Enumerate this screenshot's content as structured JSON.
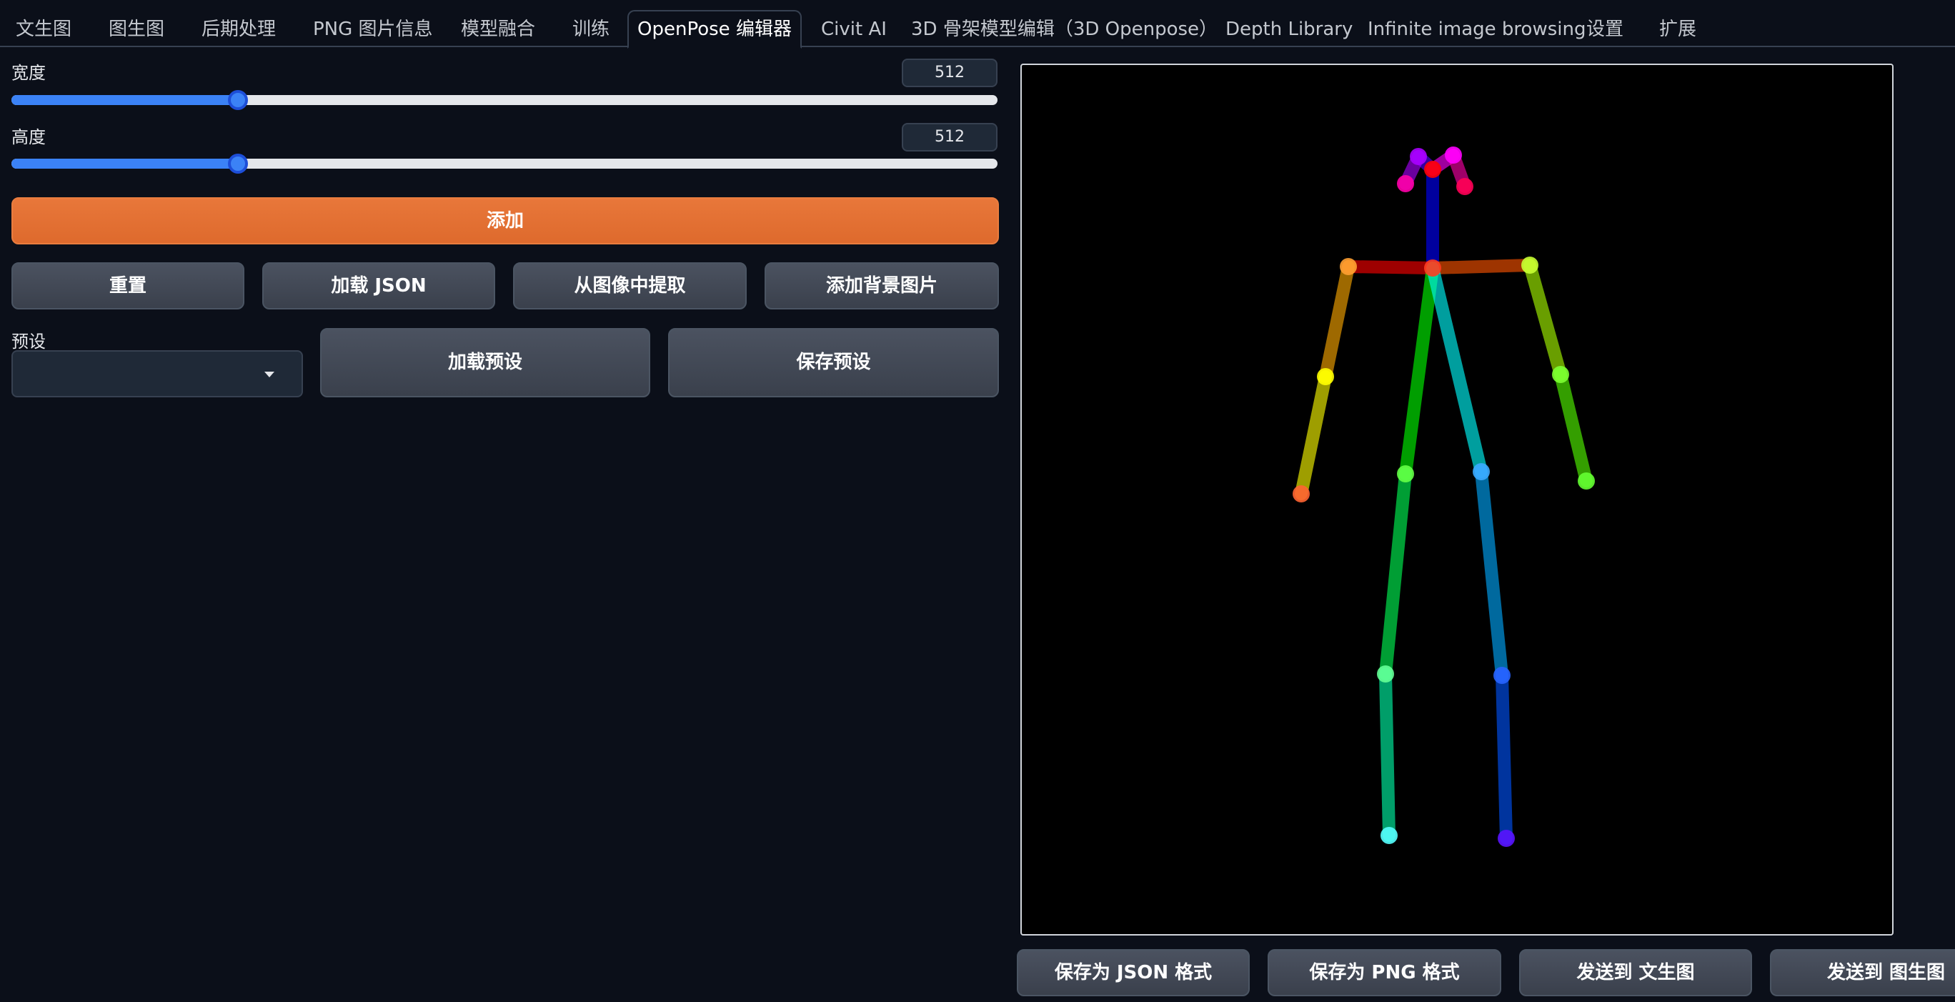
{
  "tabs": [
    {
      "label": "文生图"
    },
    {
      "label": "图生图"
    },
    {
      "label": "后期处理"
    },
    {
      "label": "PNG 图片信息"
    },
    {
      "label": "模型融合"
    },
    {
      "label": "训练"
    },
    {
      "label": "OpenPose 编辑器",
      "active": true
    },
    {
      "label": "Civit AI"
    },
    {
      "label": "3D 骨架模型编辑（3D Openpose）"
    },
    {
      "label": "Depth Library"
    },
    {
      "label": "Infinite image browsing"
    },
    {
      "label": "设置"
    },
    {
      "label": "扩展"
    }
  ],
  "controls": {
    "width_label": "宽度",
    "width_value": "512",
    "width_fraction": 0.23,
    "height_label": "高度",
    "height_value": "512",
    "height_fraction": 0.23,
    "add_label": "添加",
    "reset_label": "重置",
    "load_json_label": "加载 JSON",
    "extract_label": "从图像中提取",
    "add_bg_label": "添加背景图片",
    "preset_label": "预设",
    "preset_value": "",
    "load_preset_label": "加载预设",
    "save_preset_label": "保存预设"
  },
  "bottom_buttons": {
    "save_json": "保存为 JSON 格式",
    "save_png": "保存为 PNG 格式",
    "send_txt2img": "发送到 文生图",
    "send_img2img": "发送到 图生图"
  },
  "colors": {
    "accent": "#3b82f6",
    "primary_button": "#e26f32",
    "background": "#0b0f19"
  }
}
